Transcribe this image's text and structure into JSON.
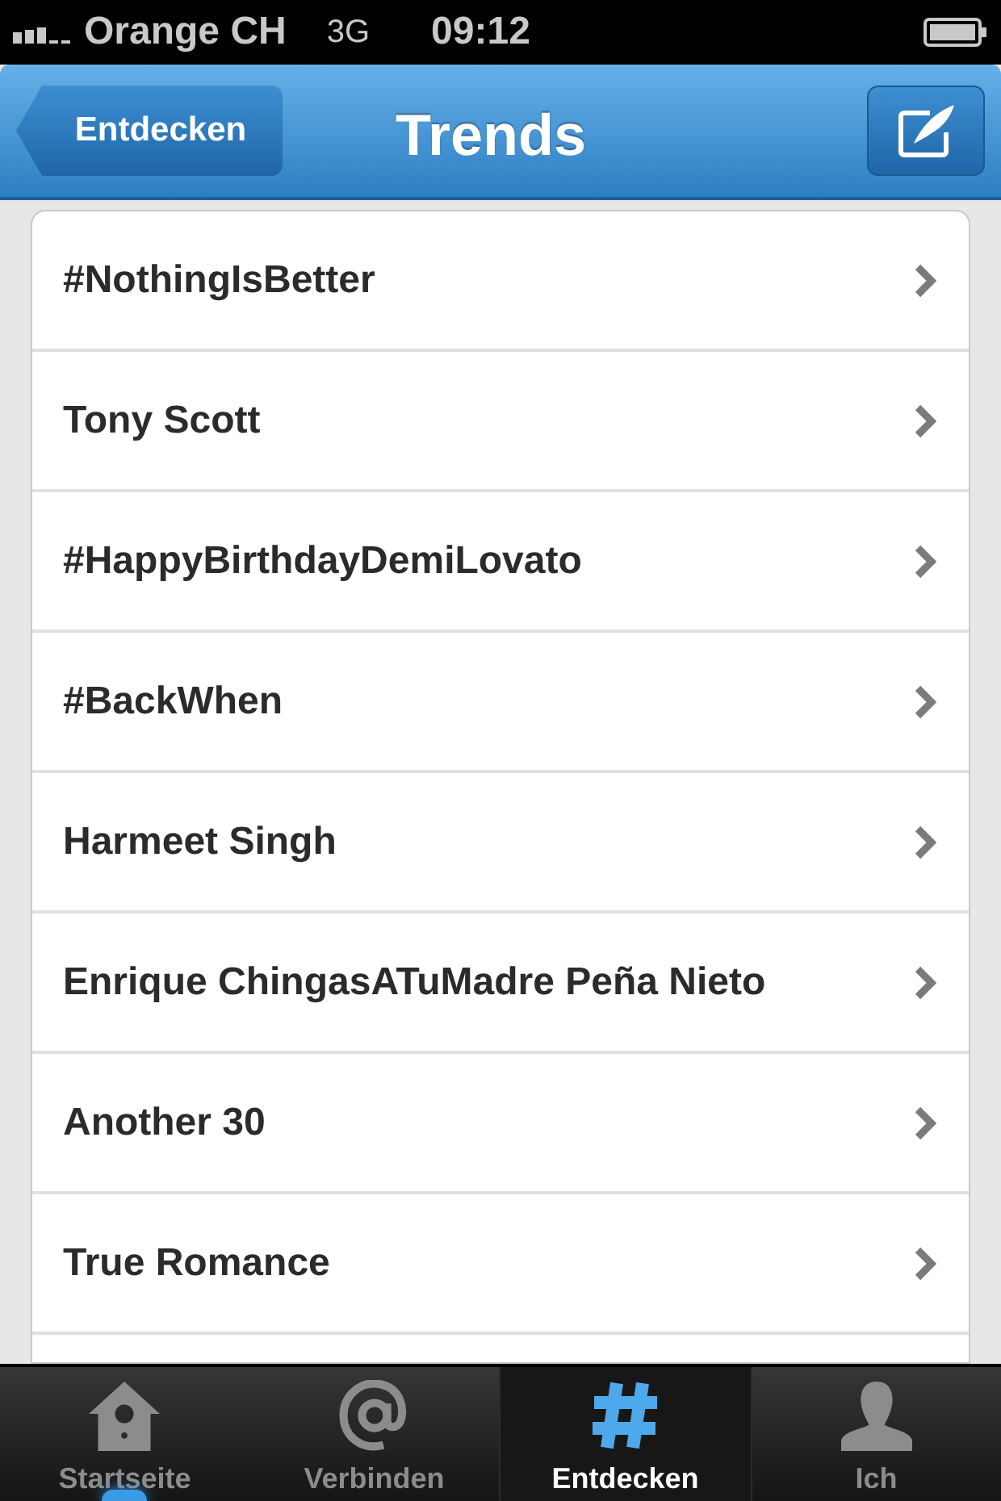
{
  "status_bar": {
    "carrier": "Orange CH",
    "network": "3G",
    "time": "09:12"
  },
  "nav_bar": {
    "back_button": "Entdecken",
    "title": "Trends"
  },
  "trends": [
    "#NothingIsBetter",
    "Tony Scott",
    "#HappyBirthdayDemiLovato",
    "#BackWhen",
    "Harmeet Singh",
    "Enrique ChingasATuMadre Peña Nieto",
    "Another 30",
    "True Romance"
  ],
  "tab_bar": [
    {
      "label": "Startseite",
      "selected": false,
      "new_indicator": true
    },
    {
      "label": "Verbinden",
      "selected": false,
      "new_indicator": false
    },
    {
      "label": "Entdecken",
      "selected": true,
      "new_indicator": false
    },
    {
      "label": "Ich",
      "selected": false,
      "new_indicator": false
    }
  ]
}
